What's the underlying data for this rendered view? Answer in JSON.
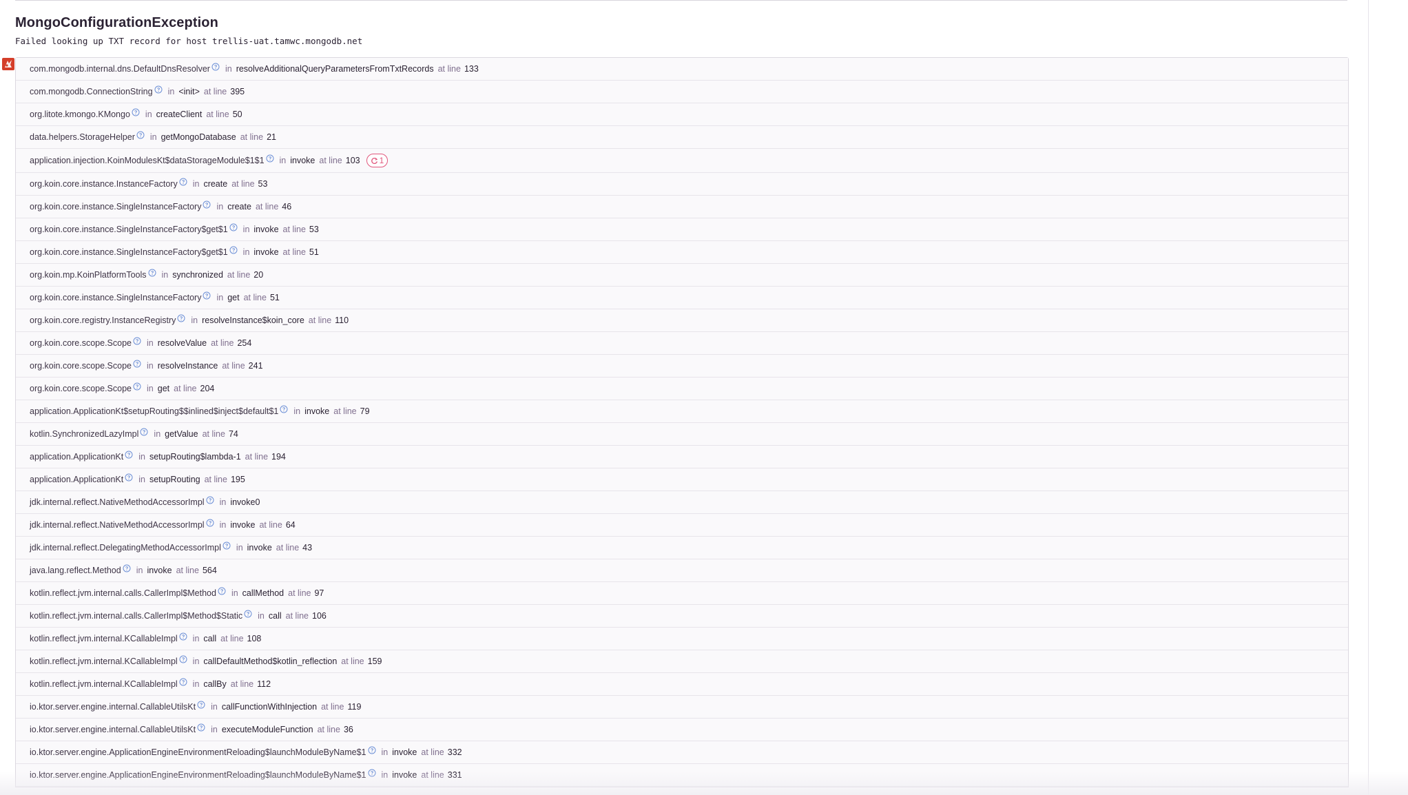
{
  "exception": {
    "type": "MongoConfigurationException",
    "message": "Failed looking up TXT record for host trellis-uat.tamwc.mongodb.net"
  },
  "platform_icon": "kotlin-platform-icon",
  "labels": {
    "in": "in",
    "at_line": "at line"
  },
  "colors": {
    "accent_pink": "#e1567c",
    "info_icon_blue": "#6c8fd6",
    "platform_red": "#d43e2a"
  },
  "frames": [
    {
      "module": "com.mongodb.internal.dns.DefaultDnsResolver",
      "function": "resolveAdditionalQueryParametersFromTxtRecords",
      "line": "133"
    },
    {
      "module": "com.mongodb.ConnectionString",
      "function": "<init>",
      "line": "395"
    },
    {
      "module": "org.litote.kmongo.KMongo",
      "function": "createClient",
      "line": "50"
    },
    {
      "module": "data.helpers.StorageHelper",
      "function": "getMongoDatabase",
      "line": "21"
    },
    {
      "module": "application.injection.KoinModulesKt$dataStorageModule$1$1",
      "function": "invoke",
      "line": "103",
      "repeat": "1"
    },
    {
      "module": "org.koin.core.instance.InstanceFactory",
      "function": "create",
      "line": "53"
    },
    {
      "module": "org.koin.core.instance.SingleInstanceFactory",
      "function": "create",
      "line": "46"
    },
    {
      "module": "org.koin.core.instance.SingleInstanceFactory$get$1",
      "function": "invoke",
      "line": "53"
    },
    {
      "module": "org.koin.core.instance.SingleInstanceFactory$get$1",
      "function": "invoke",
      "line": "51"
    },
    {
      "module": "org.koin.mp.KoinPlatformTools",
      "function": "synchronized",
      "line": "20"
    },
    {
      "module": "org.koin.core.instance.SingleInstanceFactory",
      "function": "get",
      "line": "51"
    },
    {
      "module": "org.koin.core.registry.InstanceRegistry",
      "function": "resolveInstance$koin_core",
      "line": "110"
    },
    {
      "module": "org.koin.core.scope.Scope",
      "function": "resolveValue",
      "line": "254"
    },
    {
      "module": "org.koin.core.scope.Scope",
      "function": "resolveInstance",
      "line": "241"
    },
    {
      "module": "org.koin.core.scope.Scope",
      "function": "get",
      "line": "204"
    },
    {
      "module": "application.ApplicationKt$setupRouting$$inlined$inject$default$1",
      "function": "invoke",
      "line": "79"
    },
    {
      "module": "kotlin.SynchronizedLazyImpl",
      "function": "getValue",
      "line": "74"
    },
    {
      "module": "application.ApplicationKt",
      "function": "setupRouting$lambda-1",
      "line": "194"
    },
    {
      "module": "application.ApplicationKt",
      "function": "setupRouting",
      "line": "195"
    },
    {
      "module": "jdk.internal.reflect.NativeMethodAccessorImpl",
      "function": "invoke0",
      "line": null
    },
    {
      "module": "jdk.internal.reflect.NativeMethodAccessorImpl",
      "function": "invoke",
      "line": "64"
    },
    {
      "module": "jdk.internal.reflect.DelegatingMethodAccessorImpl",
      "function": "invoke",
      "line": "43"
    },
    {
      "module": "java.lang.reflect.Method",
      "function": "invoke",
      "line": "564"
    },
    {
      "module": "kotlin.reflect.jvm.internal.calls.CallerImpl$Method",
      "function": "callMethod",
      "line": "97"
    },
    {
      "module": "kotlin.reflect.jvm.internal.calls.CallerImpl$Method$Static",
      "function": "call",
      "line": "106"
    },
    {
      "module": "kotlin.reflect.jvm.internal.KCallableImpl",
      "function": "call",
      "line": "108"
    },
    {
      "module": "kotlin.reflect.jvm.internal.KCallableImpl",
      "function": "callDefaultMethod$kotlin_reflection",
      "line": "159"
    },
    {
      "module": "kotlin.reflect.jvm.internal.KCallableImpl",
      "function": "callBy",
      "line": "112"
    },
    {
      "module": "io.ktor.server.engine.internal.CallableUtilsKt",
      "function": "callFunctionWithInjection",
      "line": "119"
    },
    {
      "module": "io.ktor.server.engine.internal.CallableUtilsKt",
      "function": "executeModuleFunction",
      "line": "36"
    },
    {
      "module": "io.ktor.server.engine.ApplicationEngineEnvironmentReloading$launchModuleByName$1",
      "function": "invoke",
      "line": "332"
    },
    {
      "module": "io.ktor.server.engine.ApplicationEngineEnvironmentReloading$launchModuleByName$1",
      "function": "invoke",
      "line": "331"
    }
  ]
}
